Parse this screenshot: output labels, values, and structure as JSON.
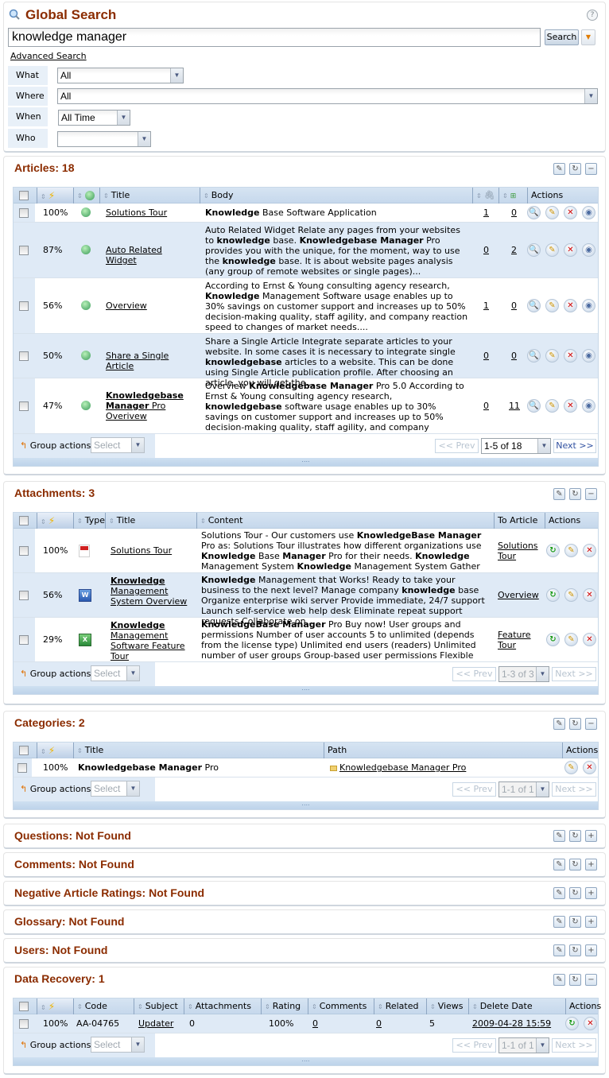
{
  "search": {
    "title": "Global Search",
    "query": "knowledge manager",
    "search_button": "Search",
    "advanced_link": "Advanced Search",
    "help": "?",
    "filters": [
      {
        "label": "What",
        "value": "All"
      },
      {
        "label": "Where",
        "value": "All"
      },
      {
        "label": "When",
        "value": "All Time"
      },
      {
        "label": "Who",
        "value": ""
      }
    ]
  },
  "common": {
    "group_actions_label": "Group actions:",
    "group_actions_select": "Select",
    "prev": "<< Prev",
    "next": "Next >>",
    "actions_header": "Actions",
    "title_header": "Title"
  },
  "articles": {
    "heading": "Articles: 18",
    "headers": {
      "title": "Title",
      "body": "Body",
      "actions": "Actions"
    },
    "page_select": "1-5 of 18",
    "rows": [
      {
        "score": "100%",
        "title": "Solutions Tour",
        "attachments": "1",
        "related": "0",
        "body": "<b>Knowledge</b> Base Software Application"
      },
      {
        "score": "87%",
        "title": "Auto Related Widget",
        "attachments": "0",
        "related": "2",
        "body": "Auto Related Widget Relate any pages from your websites to <b>knowledge</b> base. <b>Knowledgebase Manager</b> Pro provides you with the unique, for the moment, way to use the <b>knowledge</b> base. It is about website pages analysis (any group of remote websites or single pages)..."
      },
      {
        "score": "56%",
        "title": "Overview",
        "attachments": "1",
        "related": "0",
        "body": "According to Ernst &amp; Young consulting agency research, <b>Knowledge</b> Management Software usage enables up to 30% savings on customer support and increases up to 50% decision-making quality, staff agility, and company reaction speed to changes of market needs...."
      },
      {
        "score": "50%",
        "title": "Share a Single Article",
        "attachments": "0",
        "related": "0",
        "body": "Share a Single Article Integrate separate articles to your website. In some cases it is necessary to integrate single <b>knowledgebase</b> articles to a website. This can be done using Single Article publication profile. After choosing an article, you will get the..."
      },
      {
        "score": "47%",
        "title_html": "<b>Knowledgebase Manager</b> Pro Overivew",
        "attachments": "0",
        "related": "11",
        "body": "Overview <b>Knowledgebase Manager</b> Pro 5.0 According to Ernst &amp; Young consulting agency research, <b>knowledgebase</b> software usage enables up to 30% savings on customer support and increases up to 50% decision-making quality, staff agility, and company reaction..."
      }
    ]
  },
  "attachments": {
    "heading": "Attachments: 3",
    "headers": {
      "type": "Type",
      "title": "Title",
      "content": "Content",
      "to_article": "To Article",
      "actions": "Actions"
    },
    "page_select": "1-3 of 3",
    "rows": [
      {
        "score": "100%",
        "type": "pdf",
        "title_html": "Solutions Tour",
        "to_article": "Solutions Tour",
        "content": "Solutions Tour - Our customers use <b>KnowledgeBase Manager</b> Pro as: Solutions Tour illustrates how different organizations use <b>Knowledge</b> Base <b>Manager</b> Pro for their needs. <b>Knowledge</b> Management System <b>Knowledge</b> Management System Gather multiple types and sources..."
      },
      {
        "score": "56%",
        "type": "doc",
        "title_html": "<b>Knowledge</b> Management System Overview",
        "to_article": "Overview",
        "content": "<b>Knowledge</b> Management that Works! Ready to take your business to the next level? Manage company <b>knowledge</b> base Organize enterprise wiki server Provide immediate, 24/7 support Launch self-service web help desk Eliminate repeat support requests Collaborate on..."
      },
      {
        "score": "29%",
        "type": "xls",
        "title_html": "<b>Knowledge</b> Management Software Feature Tour",
        "to_article": "Feature Tour",
        "content": "<b>KnowledgeBase Manager</b> Pro Buy now! User groups and permissions Number of user accounts 5 to unlimited (depends from the license type) Unlimited end users (readers) Unlimited number of user groups Group-based user permissions Flexible and detailed user permissions..."
      }
    ]
  },
  "categories": {
    "heading": "Categories: 2",
    "headers": {
      "title": "Title",
      "path": "Path",
      "actions": "Actions"
    },
    "page_select": "1-1 of 1",
    "rows": [
      {
        "score": "100%",
        "title_html": "<b>Knowledgebase Manager</b> Pro",
        "path": "Knowledgebase Manager Pro"
      }
    ]
  },
  "empty_sections": [
    {
      "heading": "Questions: Not Found"
    },
    {
      "heading": "Comments: Not Found"
    },
    {
      "heading": "Negative Article Ratings: Not Found"
    },
    {
      "heading": "Glossary: Not Found"
    },
    {
      "heading": "Users: Not Found"
    }
  ],
  "data_recovery": {
    "heading": "Data Recovery: 1",
    "headers": {
      "code": "Code",
      "subject": "Subject",
      "attachments": "Attachments",
      "rating": "Rating",
      "comments": "Comments",
      "related": "Related",
      "views": "Views",
      "delete_date": "Delete Date",
      "actions": "Actions"
    },
    "page_select": "1-1 of 1",
    "rows": [
      {
        "score": "100%",
        "code": "AA-04765",
        "subject": "Updater",
        "attachments": "0",
        "rating": "100%",
        "comments": "0",
        "related": "0",
        "views": "5",
        "delete_date": "2009-04-28 15:59"
      }
    ]
  }
}
